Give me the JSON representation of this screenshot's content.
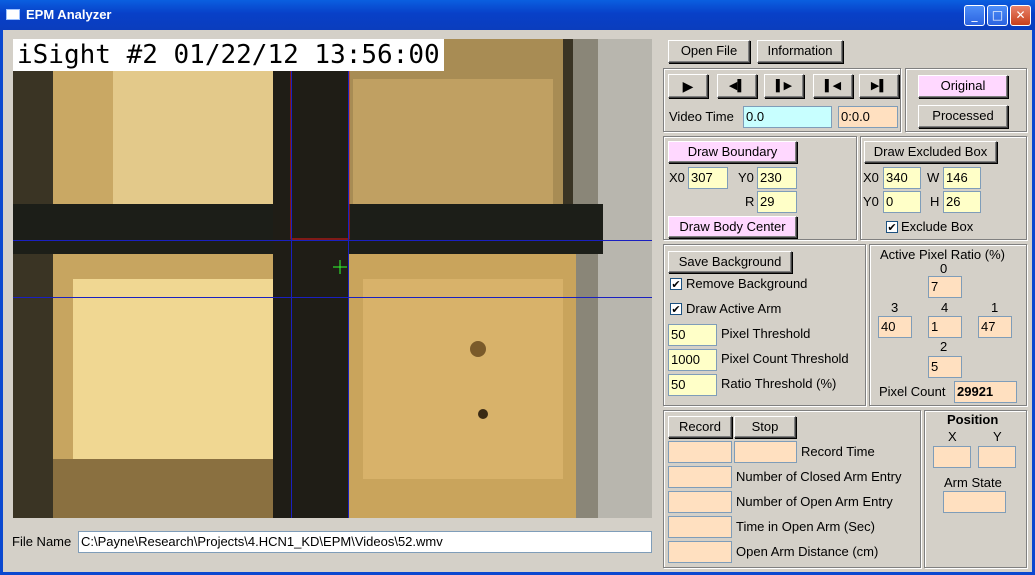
{
  "window": {
    "title": "EPM Analyzer"
  },
  "video": {
    "overlay": "iSight #2 01/22/12  13:56:00"
  },
  "file": {
    "label": "File Name",
    "path": "C:\\Payne\\Research\\Projects\\4.HCN1_KD\\EPM\\Videos\\52.wmv"
  },
  "top_buttons": {
    "open_file": "Open File",
    "information": "Information"
  },
  "playback": {
    "video_time_label": "Video Time",
    "video_time_value": "0.0",
    "video_time_hms": "0:0.0",
    "icons": [
      "play-icon",
      "step-back-icon",
      "step-forward-icon",
      "skip-start-icon",
      "skip-end-icon"
    ],
    "glyphs": [
      "▶",
      "◀▌",
      "▌▶",
      "▌◀",
      "▶▌"
    ]
  },
  "view_mode": {
    "original": "Original",
    "processed": "Processed"
  },
  "boundary": {
    "draw_boundary": "Draw Boundary",
    "x0_label": "X0",
    "x0": "307",
    "y0_label": "Y0",
    "y0": "230",
    "r_label": "R",
    "r": "29",
    "draw_body_center": "Draw Body Center"
  },
  "excluded": {
    "draw_excluded_box": "Draw Excluded Box",
    "x0_label": "X0",
    "x0": "340",
    "w_label": "W",
    "w": "146",
    "y0_label": "Y0",
    "y0": "0",
    "h_label": "H",
    "h": "26",
    "exclude_box_label": "Exclude Box",
    "exclude_box_checked": true
  },
  "background": {
    "save_background": "Save Background",
    "remove_background_label": "Remove Background",
    "draw_active_arm_label": "Draw Active Arm",
    "pixel_threshold_value": "50",
    "pixel_threshold_label": "Pixel Threshold",
    "pixel_count_threshold_value": "1000",
    "pixel_count_threshold_label": "Pixel Count Threshold",
    "ratio_threshold_value": "50",
    "ratio_threshold_label": "Ratio Threshold (%)"
  },
  "ratio": {
    "title": "Active Pixel Ratio (%)",
    "arm0_label": "0",
    "arm0": "7",
    "arm3_label": "3",
    "arm3": "40",
    "arm4_label": "4",
    "arm4": "1",
    "arm1_label": "1",
    "arm1": "47",
    "arm2_label": "2",
    "arm2": "5",
    "pixel_count_label": "Pixel Count",
    "pixel_count": "29921"
  },
  "record": {
    "record_button": "Record",
    "stop_button": "Stop",
    "record_time_label": "Record Time",
    "closed_arm_entry_label": "Number of Closed Arm Entry",
    "open_arm_entry_label": "Number of Open Arm Entry",
    "time_open_arm_label": "Time in Open Arm (Sec)",
    "open_arm_distance_label": "Open Arm Distance (cm)"
  },
  "position": {
    "title": "Position",
    "x_label": "X",
    "y_label": "Y",
    "arm_state_label": "Arm State"
  },
  "colors": {
    "title_bar": "#0a48d0",
    "pink": "#ffd8ff",
    "field_orange": "#ffe0c0",
    "field_yellow": "#ffffc8",
    "field_cyan": "#c8ffff"
  }
}
